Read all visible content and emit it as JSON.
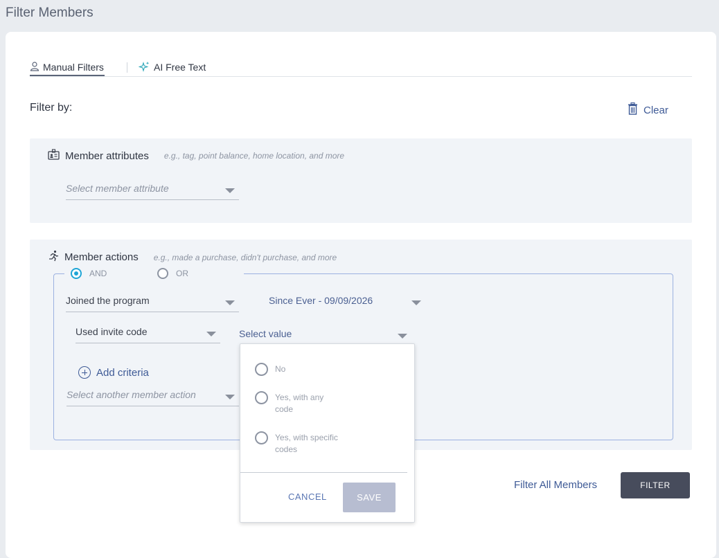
{
  "page": {
    "title": "Filter Members"
  },
  "tabs": {
    "manual": "Manual Filters",
    "ai": "AI Free Text"
  },
  "filter_by": {
    "label": "Filter by:",
    "clear": "Clear"
  },
  "member_attributes": {
    "title": "Member attributes",
    "hint": "e.g., tag, point balance, home location, and more",
    "select_placeholder": "Select member attribute"
  },
  "member_actions": {
    "title": "Member actions",
    "hint": "e.g., made a purchase, didn't purchase, and more",
    "logic": {
      "and": "AND",
      "or": "OR",
      "selected": "AND"
    },
    "action_value": "Joined the program",
    "date_range": "Since Ever - 09/09/2026",
    "condition_value": "Used invite code",
    "select_value_placeholder": "Select value",
    "add_criteria": "Add criteria",
    "another_action_placeholder": "Select another member action"
  },
  "dropdown": {
    "options": [
      "No",
      "Yes, with any code",
      "Yes, with specific codes"
    ],
    "cancel": "CANCEL",
    "save": "SAVE"
  },
  "footer": {
    "filter_all": "Filter All Members",
    "filter": "FILTER"
  },
  "colors": {
    "accent": "#3e5a96",
    "radio_selected": "#1fa5d6",
    "primary_button": "#474c5c",
    "disabled_button": "#b7bdd1",
    "section_bg": "#f1f4f8"
  }
}
